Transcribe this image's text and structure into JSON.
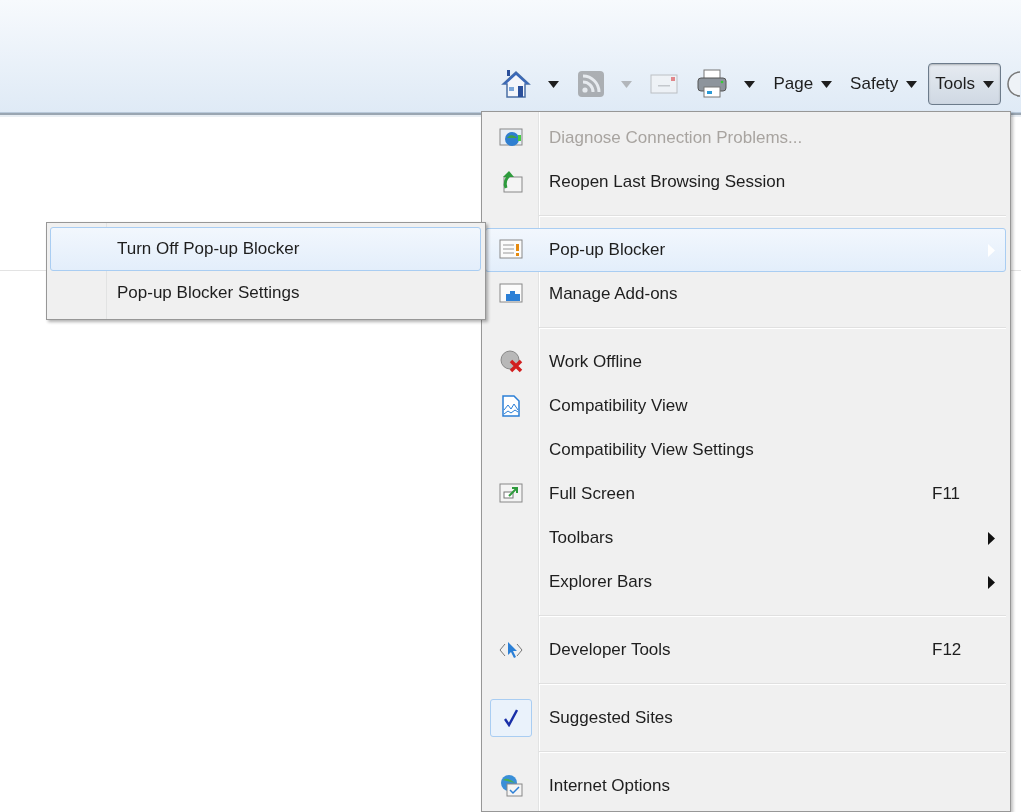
{
  "toolbar": {
    "buttons": [
      {
        "kind": "home",
        "dropdown": true,
        "disabled": false,
        "selected": false
      },
      {
        "kind": "feed",
        "dropdown": true,
        "disabled": true,
        "selected": false
      },
      {
        "kind": "mail",
        "dropdown": false,
        "disabled": true,
        "selected": false
      },
      {
        "kind": "print",
        "dropdown": true,
        "disabled": false,
        "selected": false
      },
      {
        "kind": "menu",
        "label": "Page",
        "dropdown": true,
        "disabled": false,
        "selected": false
      },
      {
        "kind": "menu",
        "label": "Safety",
        "dropdown": true,
        "disabled": false,
        "selected": false
      },
      {
        "kind": "menu",
        "label": "Tools",
        "dropdown": true,
        "disabled": false,
        "selected": true
      },
      {
        "kind": "help",
        "dropdown": false,
        "disabled": false,
        "selected": false
      }
    ]
  },
  "tools_menu": {
    "items": [
      {
        "kind": "item",
        "label": "Diagnose Connection Problems...",
        "disabled": true,
        "selected": false,
        "checked": false,
        "submenu": false
      },
      {
        "kind": "item",
        "label": "Reopen Last Browsing Session",
        "disabled": false,
        "selected": false,
        "checked": false,
        "submenu": false
      },
      {
        "kind": "separator"
      },
      {
        "kind": "item",
        "label": "Pop-up Blocker",
        "disabled": false,
        "selected": true,
        "checked": false,
        "submenu": true
      },
      {
        "kind": "item",
        "label": "Manage Add-ons",
        "disabled": false,
        "selected": false,
        "checked": false,
        "submenu": false
      },
      {
        "kind": "separator"
      },
      {
        "kind": "item",
        "label": "Work Offline",
        "disabled": false,
        "selected": false,
        "checked": false,
        "submenu": false
      },
      {
        "kind": "item",
        "label": "Compatibility View",
        "disabled": false,
        "selected": false,
        "checked": false,
        "submenu": false
      },
      {
        "kind": "item",
        "label": "Compatibility View Settings",
        "disabled": false,
        "selected": false,
        "checked": false,
        "submenu": false
      },
      {
        "kind": "item",
        "label": "Full Screen",
        "shortcut": "F11",
        "disabled": false,
        "selected": false,
        "checked": false,
        "submenu": false
      },
      {
        "kind": "item",
        "label": "Toolbars",
        "disabled": false,
        "selected": false,
        "checked": false,
        "submenu": true
      },
      {
        "kind": "item",
        "label": "Explorer Bars",
        "disabled": false,
        "selected": false,
        "checked": false,
        "submenu": true
      },
      {
        "kind": "separator"
      },
      {
        "kind": "item",
        "label": "Developer Tools",
        "shortcut": "F12",
        "disabled": false,
        "selected": false,
        "checked": false,
        "submenu": false
      },
      {
        "kind": "separator"
      },
      {
        "kind": "item",
        "label": "Suggested Sites",
        "disabled": false,
        "selected": false,
        "checked": true,
        "submenu": false
      },
      {
        "kind": "separator"
      },
      {
        "kind": "item",
        "label": "Internet Options",
        "disabled": false,
        "selected": false,
        "checked": false,
        "submenu": false
      }
    ]
  },
  "popup_submenu": {
    "items": [
      {
        "label": "Turn Off Pop-up Blocker",
        "selected": true
      },
      {
        "label": "Pop-up Blocker Settings",
        "selected": false
      }
    ]
  }
}
